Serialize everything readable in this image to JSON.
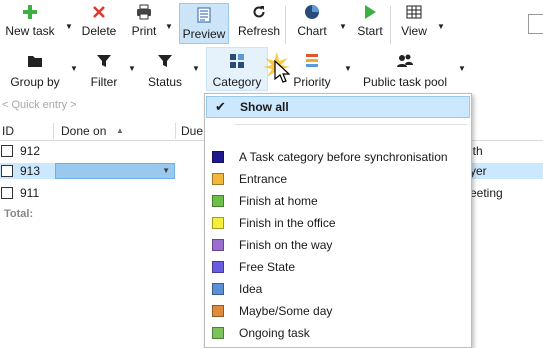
{
  "toolbar": {
    "new_task": "New task",
    "delete": "Delete",
    "print": "Print",
    "preview": "Preview",
    "refresh": "Refresh",
    "chart": "Chart",
    "start": "Start",
    "view": "View"
  },
  "filterbar": {
    "group_by": "Group by",
    "filter": "Filter",
    "status": "Status",
    "category": "Category",
    "priority": "Priority",
    "public_task_pool": "Public task pool"
  },
  "quick_entry": {
    "placeholder": "< Quick entry >"
  },
  "grid": {
    "columns": {
      "id": "ID",
      "done_on": "Done on",
      "due": "Due"
    },
    "rows": [
      {
        "id": "912",
        "tail": "ith"
      },
      {
        "id": "913",
        "tail": "yer"
      },
      {
        "id": "911",
        "tail": "eeting"
      }
    ],
    "total_label": "Total:"
  },
  "category_menu": {
    "show_all": "Show all",
    "items": [
      {
        "label": "A Task category before synchronisation",
        "color": "#1f1a8c"
      },
      {
        "label": "Entrance",
        "color": "#f4b73e"
      },
      {
        "label": "Finish at home",
        "color": "#6cc04a"
      },
      {
        "label": "Finish in the office",
        "color": "#f5ee3a"
      },
      {
        "label": "Finish on the way",
        "color": "#9b6fd1"
      },
      {
        "label": "Free State",
        "color": "#6a5ce0"
      },
      {
        "label": "Idea",
        "color": "#5b8fd6"
      },
      {
        "label": "Maybe/Some day",
        "color": "#e08a3c"
      },
      {
        "label": "Ongoing task",
        "color": "#7dc35b"
      }
    ]
  },
  "colors": {
    "accent": "#0078d7",
    "selection": "#cce8ff",
    "new_task_icon": "#3cb043",
    "delete_icon": "#e03a2f",
    "start_icon": "#3cb043"
  }
}
